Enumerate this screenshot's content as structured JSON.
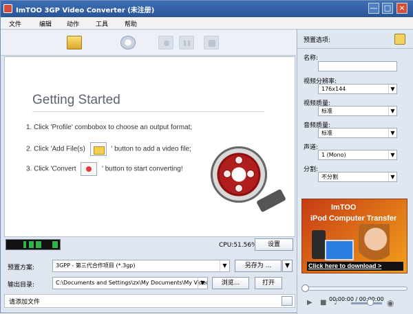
{
  "window": {
    "title": "ImTOO 3GP Video Converter (未注册)",
    "controls": {
      "min": "—",
      "max": "□",
      "close": "×"
    }
  },
  "menu": [
    "文件",
    "编辑",
    "动作",
    "工具",
    "帮助"
  ],
  "getting_started": {
    "title": "Getting Started",
    "step1": "1. Click 'Profile' combobox to choose an output format;",
    "step2_a": "2. Click 'Add File(s)",
    "step2_b": "' button to add a video file;",
    "step3_a": "3. Click 'Convert",
    "step3_b": "' button to start converting!"
  },
  "status": {
    "cpu": "CPU:51.56%",
    "settings_button": "设置"
  },
  "profile_row": {
    "label": "预置方案:",
    "value": "3GPP - 第三代合作项目 (*.3gp)",
    "save_as": "另存为 ...",
    "menu_arrow": "▼"
  },
  "output_row": {
    "label": "输出目录:",
    "value": "C:\\Documents and Settings\\zx\\My Documents\\My Videos",
    "browse": "浏览...",
    "open": "打开"
  },
  "bottom": {
    "hint": "请添加文件"
  },
  "preset_panel": {
    "title": "预置选项:",
    "name_label": "名称:",
    "name_value": "",
    "video_res_label": "视频分辨率:",
    "video_res_value": "176x144",
    "video_quality_label": "视频质量:",
    "video_quality_value": "标准",
    "audio_quality_label": "音频质量:",
    "audio_quality_value": "标准",
    "channel_label": "声道:",
    "channel_value": "1 (Mono)",
    "split_label": "分割:",
    "split_value": "不分割"
  },
  "ad": {
    "brand": "ImTOO",
    "product": "iPod Computer Transfer",
    "link": "Click here to download >"
  },
  "player": {
    "time": "00:00:00 / 00:00:00",
    "progress": 0.0,
    "volume": 0.6
  },
  "colors": {
    "title_bar": "#2a5596",
    "accent_red": "#d74a3a",
    "meter_green": "#31b34a"
  }
}
